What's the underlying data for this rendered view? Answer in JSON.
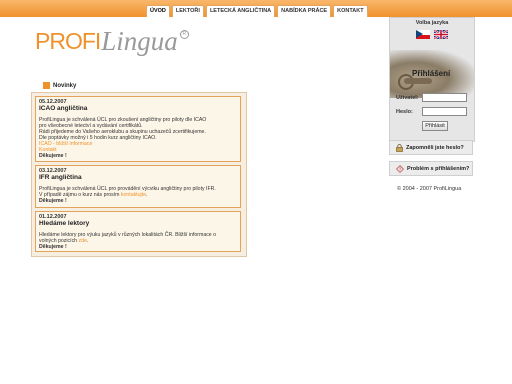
{
  "nav": {
    "tabs": [
      {
        "label": "ÚVOD"
      },
      {
        "label": "LEKTOŘI"
      },
      {
        "label": "LETECKÁ ANGLIČTINA"
      },
      {
        "label": "NABÍDKA PRÁCE"
      },
      {
        "label": "KONTAKT"
      }
    ]
  },
  "logo": {
    "profi": "PROFI",
    "lingua": "Lingua",
    "reg": "R"
  },
  "news": {
    "title": "Novinky",
    "items": [
      {
        "date": "05.12.2007",
        "title": "ICAO angličtina",
        "lines": [
          "ProfiLingua je schválená ÚCL pro zkoušení angličtiny pro piloty dle ICAO",
          "pro všeobecné letectví a vydávání certifikátů.",
          "Rádi přijedeme do Vašeho aeroklubu a skupinu uchazečů zcertifikujeme.",
          "Dle poptávky možný i 5 hodin kurz angličtiny ICAO."
        ],
        "link1": "ICAO - bližší informace",
        "link2": "Kontakt",
        "thanks": "Děkujeme !"
      },
      {
        "date": "03.12.2007",
        "title": "IFR angličtina",
        "line1": "ProfiLingua je schválená ÚCL pro provádění výcviku angličtiny pro piloty IFR.",
        "line2_prefix": "V případě zájmu o kurz nás prosím ",
        "line2_link": "kontaktujte",
        "line2_suffix": ".",
        "thanks": "Děkujeme !"
      },
      {
        "date": "01.12.2007",
        "title": "Hledáme lektory",
        "line1": "Hledáme lektory pro výuku jazyků v různých lokalitách ČR. Bližší informace o",
        "line2_prefix": "volných pozicích ",
        "line2_link": "zde",
        "line2_suffix": ".",
        "thanks": "Děkujeme !"
      }
    ]
  },
  "sidebar": {
    "language_title": "Volba jazyka",
    "login_title": "Přihlášení",
    "username_label": "Uživatel:",
    "password_label": "Heslo:",
    "login_button": "Přihlásit",
    "forgot_password": "Zapomněli jste heslo?",
    "login_problem": "Problém s přihlášením?",
    "copyright": "© 2004 - 2007 ProfiLingua"
  },
  "colors": {
    "accent": "#f0922c",
    "news_border": "#e3a35c",
    "news_bg": "#fcf6e9"
  },
  "icons": [
    "cz-flag-icon",
    "uk-flag-icon",
    "lock-icon",
    "help-icon"
  ]
}
